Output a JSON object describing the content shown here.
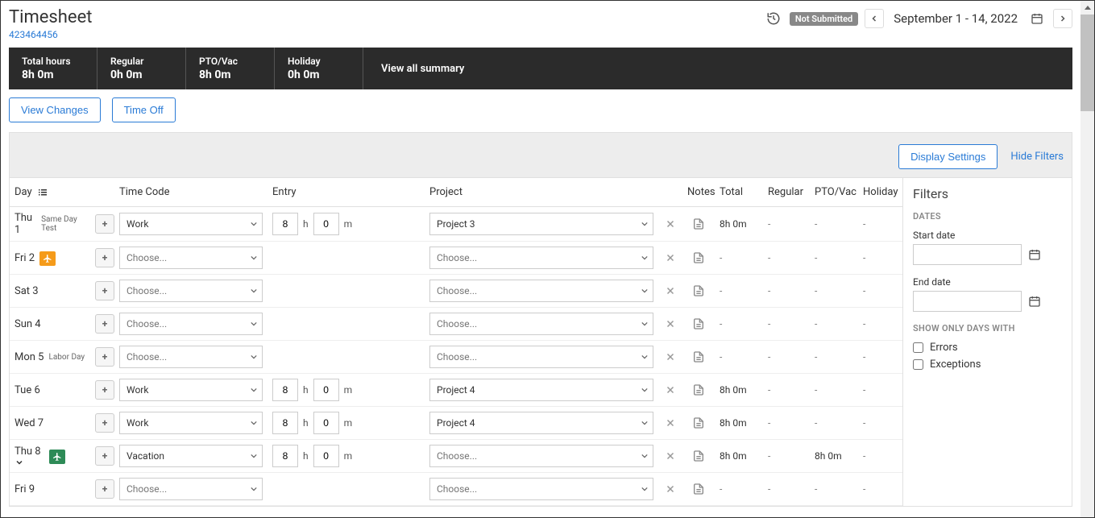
{
  "pageTitle": "Timesheet",
  "subId": "423464456",
  "statusBadge": "Not Submitted",
  "dateRange": "September 1 - 14, 2022",
  "summary": [
    {
      "label": "Total hours",
      "value": "8h 0m"
    },
    {
      "label": "Regular",
      "value": "0h 0m"
    },
    {
      "label": "PTO/Vac",
      "value": "8h 0m"
    },
    {
      "label": "Holiday",
      "value": "0h 0m"
    }
  ],
  "viewAllSummary": "View all summary",
  "buttons": {
    "viewChanges": "View Changes",
    "timeOff": "Time Off",
    "displaySettings": "Display Settings",
    "hideFilters": "Hide Filters"
  },
  "columns": {
    "day": "Day",
    "timecode": "Time Code",
    "entry": "Entry",
    "project": "Project",
    "notes": "Notes",
    "total": "Total",
    "regular": "Regular",
    "ptovac": "PTO/Vac",
    "holiday": "Holiday"
  },
  "rows": [
    {
      "day": "Thu 1",
      "sub": "Same Day Test",
      "badge": "",
      "chev": false,
      "timecode": "Work",
      "hours": "8",
      "mins": "0",
      "project": "Project 3",
      "total": "8h 0m",
      "regular": "-",
      "ptovac": "-",
      "holiday": "-"
    },
    {
      "day": "Fri 2",
      "sub": "",
      "badge": "orange",
      "chev": false,
      "timecode": "Choose...",
      "hours": "",
      "mins": "",
      "project": "Choose...",
      "total": "-",
      "regular": "-",
      "ptovac": "-",
      "holiday": "-"
    },
    {
      "day": "Sat 3",
      "sub": "",
      "badge": "",
      "chev": false,
      "timecode": "Choose...",
      "hours": "",
      "mins": "",
      "project": "Choose...",
      "total": "-",
      "regular": "-",
      "ptovac": "-",
      "holiday": "-"
    },
    {
      "day": "Sun 4",
      "sub": "",
      "badge": "",
      "chev": false,
      "timecode": "Choose...",
      "hours": "",
      "mins": "",
      "project": "Choose...",
      "total": "-",
      "regular": "-",
      "ptovac": "-",
      "holiday": "-"
    },
    {
      "day": "Mon 5",
      "sub": "Labor Day",
      "badge": "",
      "chev": false,
      "timecode": "Choose...",
      "hours": "",
      "mins": "",
      "project": "Choose...",
      "total": "-",
      "regular": "-",
      "ptovac": "-",
      "holiday": "-"
    },
    {
      "day": "Tue 6",
      "sub": "",
      "badge": "",
      "chev": false,
      "timecode": "Work",
      "hours": "8",
      "mins": "0",
      "project": "Project 4",
      "total": "8h 0m",
      "regular": "-",
      "ptovac": "-",
      "holiday": "-"
    },
    {
      "day": "Wed 7",
      "sub": "",
      "badge": "",
      "chev": false,
      "timecode": "Work",
      "hours": "8",
      "mins": "0",
      "project": "Project 4",
      "total": "8h 0m",
      "regular": "-",
      "ptovac": "-",
      "holiday": "-"
    },
    {
      "day": "Thu 8",
      "sub": "",
      "badge": "green",
      "chev": true,
      "timecode": "Vacation",
      "hours": "8",
      "mins": "0",
      "project": "Choose...",
      "total": "8h 0m",
      "regular": "-",
      "ptovac": "8h 0m",
      "holiday": "-"
    },
    {
      "day": "Fri 9",
      "sub": "",
      "badge": "",
      "chev": false,
      "timecode": "Choose...",
      "hours": "",
      "mins": "",
      "project": "Choose...",
      "total": "-",
      "regular": "-",
      "ptovac": "-",
      "holiday": "-"
    }
  ],
  "filters": {
    "title": "Filters",
    "dates": "DATES",
    "startDate": "Start date",
    "endDate": "End date",
    "showOnly": "SHOW ONLY DAYS WITH",
    "errors": "Errors",
    "exceptions": "Exceptions"
  },
  "units": {
    "h": "h",
    "m": "m"
  }
}
